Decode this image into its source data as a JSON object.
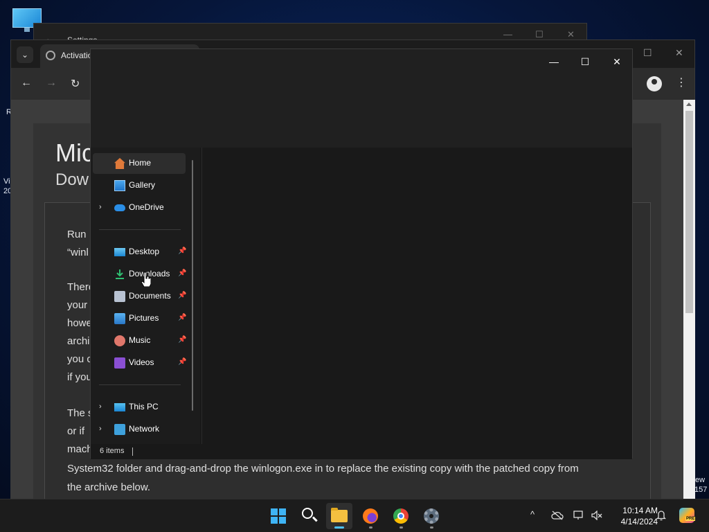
{
  "desktop": {
    "edge_left": [
      "R",
      "Vi",
      "20"
    ],
    "edge_right": [
      "ew",
      "157"
    ]
  },
  "settings_window": {
    "title": "Settings",
    "back_glyph": "←",
    "minimize_glyph": "—",
    "maximize_glyph": "☐",
    "close_glyph": "✕"
  },
  "browser": {
    "tab_list_glyph": "⌄",
    "tab_title": "Activatio",
    "minimize_glyph": "—",
    "maximize_glyph": "☐",
    "close_glyph": "✕",
    "back_glyph": "←",
    "forward_glyph": "→",
    "reload_glyph": "↻",
    "menu_glyph": "⋮",
    "page": {
      "title": "Mic",
      "subtitle": "Dow",
      "paragraphs": [
        [
          "Run",
          "“winl"
        ],
        [
          "There",
          "your",
          "howe",
          "archi",
          "you c",
          "if you"
        ],
        [
          "The s",
          "or if",
          "mach"
        ]
      ],
      "full_lines": [
        "System32 folder and drag-and-drop the winlogon.exe in to replace the existing copy with the patched copy from",
        "the archive below."
      ]
    }
  },
  "explorer": {
    "minimize_glyph": "—",
    "maximize_glyph": "☐",
    "close_glyph": "✕",
    "nav": [
      {
        "label": "Home",
        "icon": "home-icon",
        "active": true,
        "chevron": false,
        "pinned": false
      },
      {
        "label": "Gallery",
        "icon": "gallery-icon",
        "active": false,
        "chevron": false,
        "pinned": false
      },
      {
        "label": "OneDrive",
        "icon": "cloud-icon",
        "active": false,
        "chevron": true,
        "pinned": false
      },
      {
        "label": "Desktop",
        "icon": "desktop-icon",
        "active": false,
        "chevron": false,
        "pinned": true
      },
      {
        "label": "Downloads",
        "icon": "download-icon",
        "active": false,
        "chevron": false,
        "pinned": true
      },
      {
        "label": "Documents",
        "icon": "documents-icon",
        "active": false,
        "chevron": false,
        "pinned": true
      },
      {
        "label": "Pictures",
        "icon": "pictures-icon",
        "active": false,
        "chevron": false,
        "pinned": true
      },
      {
        "label": "Music",
        "icon": "music-icon",
        "active": false,
        "chevron": false,
        "pinned": true
      },
      {
        "label": "Videos",
        "icon": "videos-icon",
        "active": false,
        "chevron": false,
        "pinned": true
      },
      {
        "label": "This PC",
        "icon": "computer-icon",
        "active": false,
        "chevron": true,
        "pinned": false
      },
      {
        "label": "Network",
        "icon": "network-icon",
        "active": false,
        "chevron": true,
        "pinned": false
      }
    ],
    "chevron_glyph": "›",
    "pin_glyph": "📌",
    "status_count": "6 items"
  },
  "taskbar": {
    "apps": [
      "start",
      "search",
      "file-explorer",
      "firefox",
      "chrome",
      "settings"
    ],
    "tray_overflow_glyph": "^",
    "time": "10:14 AM",
    "date": "4/14/2024",
    "copilot_badge": "PRE"
  },
  "colors": {
    "accent": "#4cc2ff",
    "explorer_bg": "#191919",
    "taskbar_bg": "#1c1c1c"
  }
}
